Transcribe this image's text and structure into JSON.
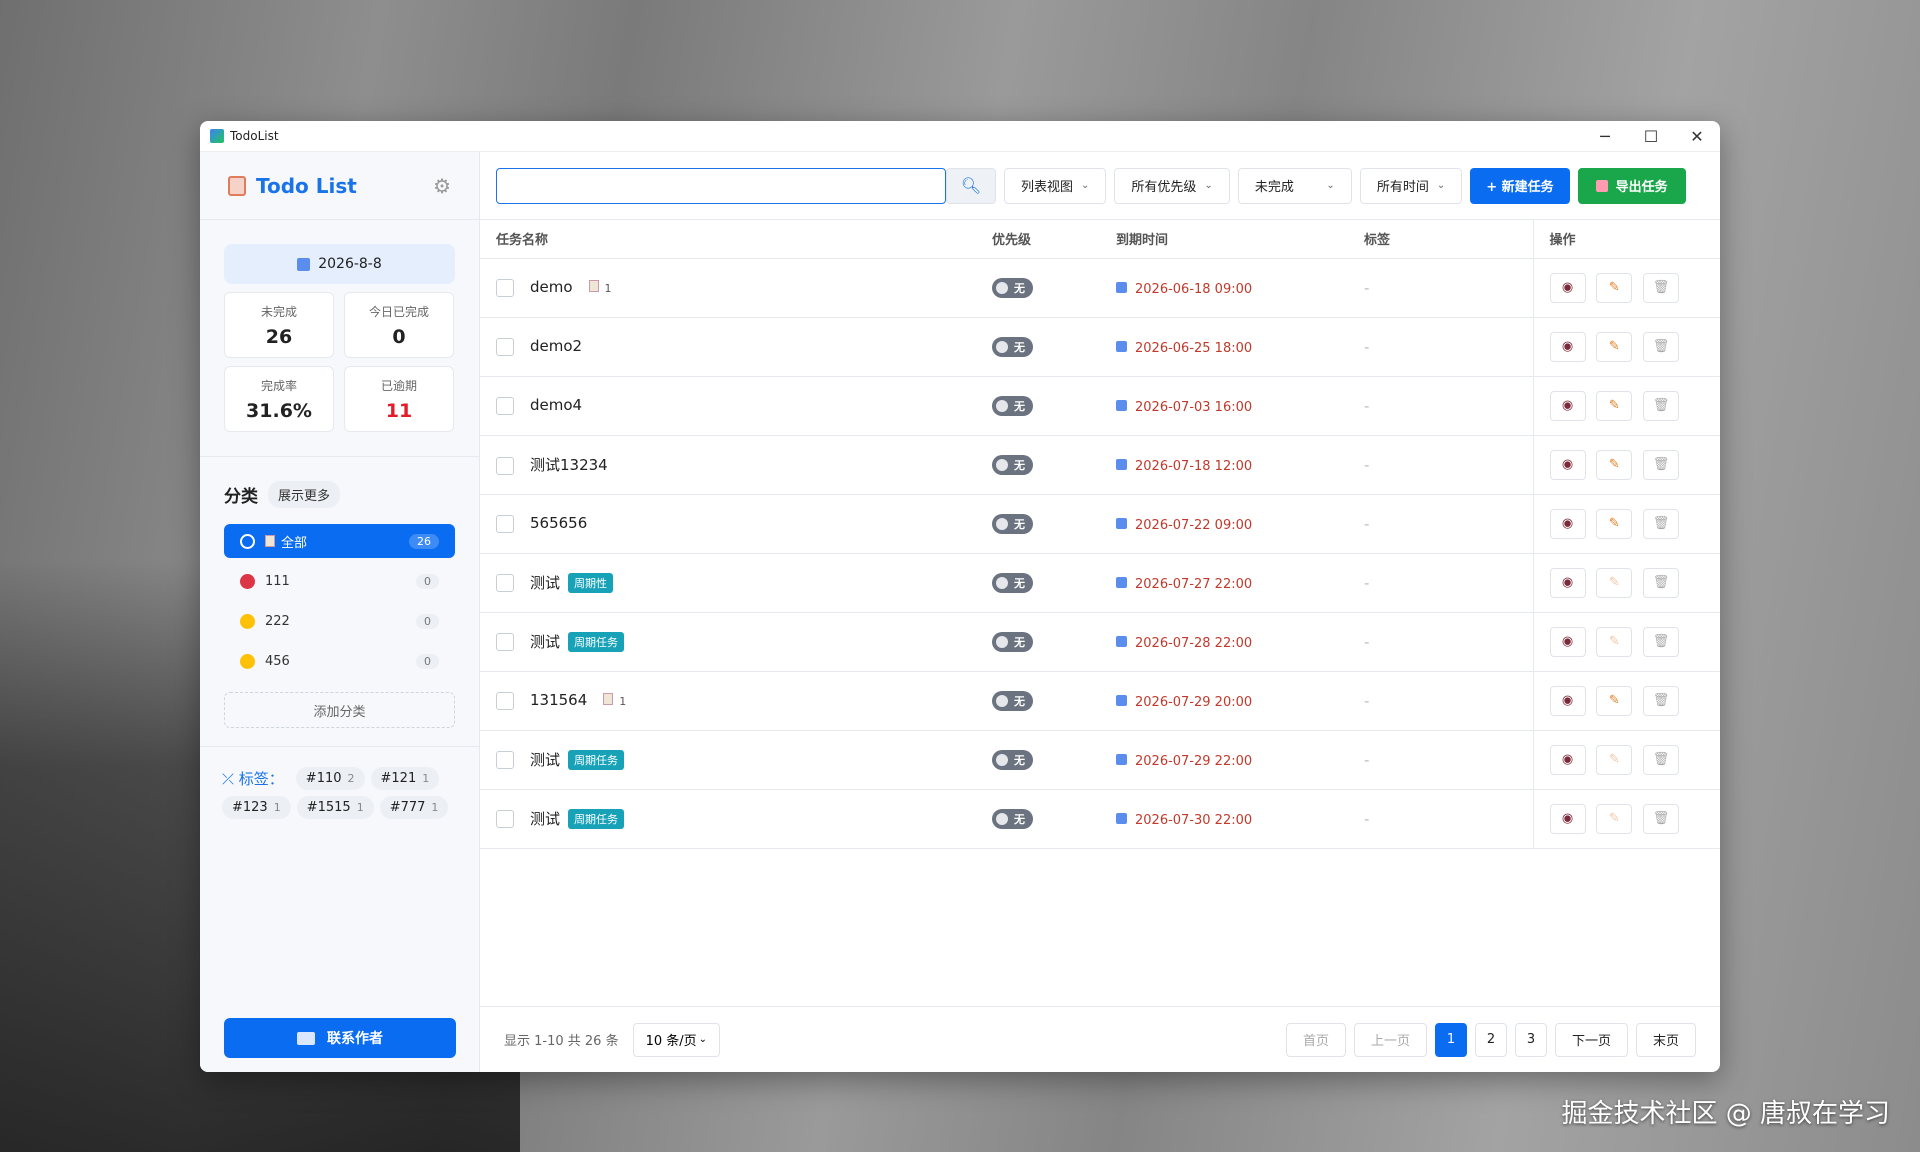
{
  "window": {
    "title": "TodoList",
    "minimize": "─",
    "maximize": "☐",
    "close": "✕"
  },
  "sidebar": {
    "brand": "Todo List",
    "date": "2026-8-8",
    "stats": [
      {
        "label": "未完成",
        "value": "26"
      },
      {
        "label": "今日已完成",
        "value": "0"
      },
      {
        "label": "完成率",
        "value": "31.6%"
      },
      {
        "label": "已逾期",
        "value": "11"
      }
    ],
    "categories_title": "分类",
    "show_more": "展示更多",
    "categories": [
      {
        "label": "全部",
        "count": "26",
        "color": "#ffffff"
      },
      {
        "label": "111",
        "count": "0",
        "color": "#dc3545"
      },
      {
        "label": "222",
        "count": "0",
        "color": "#ffc107"
      },
      {
        "label": "456",
        "count": "0",
        "color": "#ffc107"
      }
    ],
    "add_category": "添加分类",
    "tags_label": "标签：",
    "tags": [
      {
        "name": "#110",
        "count": "2"
      },
      {
        "name": "#121",
        "count": "1"
      },
      {
        "name": "#123",
        "count": "1"
      },
      {
        "name": "#1515",
        "count": "1"
      },
      {
        "name": "#777",
        "count": "1"
      }
    ],
    "contact": "联系作者"
  },
  "toolbar": {
    "search_value": "",
    "view": "列表视图",
    "priority": "所有优先级",
    "status": "未完成",
    "time": "所有时间",
    "new_task": "+ 新建任务",
    "export": "导出任务"
  },
  "table": {
    "headers": [
      "任务名称",
      "优先级",
      "到期时间",
      "标签",
      "操作"
    ],
    "rows": [
      {
        "name": "demo",
        "sub": "1",
        "badge": "",
        "priority": "无",
        "due": "2026-06-18 09:00",
        "tag": "-",
        "edit_disabled": false
      },
      {
        "name": "demo2",
        "sub": "",
        "badge": "",
        "priority": "无",
        "due": "2026-06-25 18:00",
        "tag": "-",
        "edit_disabled": false
      },
      {
        "name": "demo4",
        "sub": "",
        "badge": "",
        "priority": "无",
        "due": "2026-07-03 16:00",
        "tag": "-",
        "edit_disabled": false
      },
      {
        "name": "测试13234",
        "sub": "",
        "badge": "",
        "priority": "无",
        "due": "2026-07-18 12:00",
        "tag": "-",
        "edit_disabled": false
      },
      {
        "name": "565656",
        "sub": "",
        "badge": "",
        "priority": "无",
        "due": "2026-07-22 09:00",
        "tag": "-",
        "edit_disabled": false
      },
      {
        "name": "测试",
        "sub": "",
        "badge": "周期性",
        "priority": "无",
        "due": "2026-07-27 22:00",
        "tag": "-",
        "edit_disabled": true
      },
      {
        "name": "测试",
        "sub": "",
        "badge": "周期任务",
        "priority": "无",
        "due": "2026-07-28 22:00",
        "tag": "-",
        "edit_disabled": true
      },
      {
        "name": "131564",
        "sub": "1",
        "badge": "",
        "priority": "无",
        "due": "2026-07-29 20:00",
        "tag": "-",
        "edit_disabled": false
      },
      {
        "name": "测试",
        "sub": "",
        "badge": "周期任务",
        "priority": "无",
        "due": "2026-07-29 22:00",
        "tag": "-",
        "edit_disabled": true
      },
      {
        "name": "测试",
        "sub": "",
        "badge": "周期任务",
        "priority": "无",
        "due": "2026-07-30 22:00",
        "tag": "-",
        "edit_disabled": true
      }
    ]
  },
  "footer": {
    "info": "显示 1-10 共 26 条",
    "page_size": "10 条/页",
    "first": "首页",
    "prev": "上一页",
    "pages": [
      "1",
      "2",
      "3"
    ],
    "current_page": "1",
    "next": "下一页",
    "last": "末页"
  },
  "watermark": "掘金技术社区 @ 唐叔在学习"
}
